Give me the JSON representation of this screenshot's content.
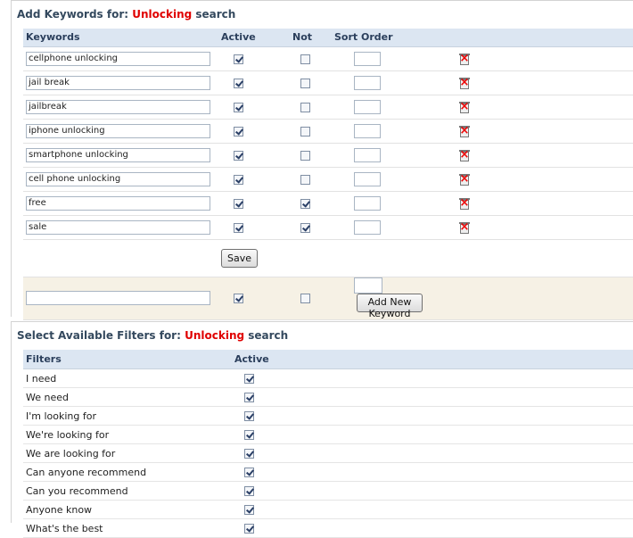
{
  "keywords_panel": {
    "title_prefix": "Add Keywords for: ",
    "title_highlight": "Unlocking",
    "title_suffix": " search",
    "columns": {
      "keywords": "Keywords",
      "active": "Active",
      "not": "Not",
      "sort_order": "Sort Order"
    },
    "rows": [
      {
        "keyword": "cellphone unlocking",
        "active": true,
        "not": false
      },
      {
        "keyword": "jail break",
        "active": true,
        "not": false
      },
      {
        "keyword": "jailbreak",
        "active": true,
        "not": false
      },
      {
        "keyword": "iphone unlocking",
        "active": true,
        "not": false
      },
      {
        "keyword": "smartphone unlocking",
        "active": true,
        "not": false
      },
      {
        "keyword": "cell phone unlocking",
        "active": true,
        "not": false
      },
      {
        "keyword": "free",
        "active": true,
        "not": true
      },
      {
        "keyword": "sale",
        "active": true,
        "not": true
      }
    ],
    "save_label": "Save",
    "new_row": {
      "keyword": "",
      "active": true,
      "not": false,
      "add_label": "Add New Keyword"
    }
  },
  "filters_panel": {
    "title_prefix": "Select Available Filters for: ",
    "title_highlight": "Unlocking",
    "title_suffix": " search",
    "columns": {
      "filters": "Filters",
      "active": "Active"
    },
    "rows": [
      {
        "label": "I need",
        "active": true
      },
      {
        "label": "We need",
        "active": true
      },
      {
        "label": "I'm looking for",
        "active": true
      },
      {
        "label": "We're looking for",
        "active": true
      },
      {
        "label": "We are looking for",
        "active": true
      },
      {
        "label": "Can anyone recommend",
        "active": true
      },
      {
        "label": "Can you recommend",
        "active": true
      },
      {
        "label": "Anyone know",
        "active": true
      },
      {
        "label": "What's the best",
        "active": true
      }
    ]
  },
  "colors": {
    "highlight": "#e00000",
    "title": "#34495e",
    "header_bg": "#dce6f2",
    "add_row_bg": "#f6f1e5"
  },
  "icons": {
    "delete": "trash-x-icon"
  }
}
